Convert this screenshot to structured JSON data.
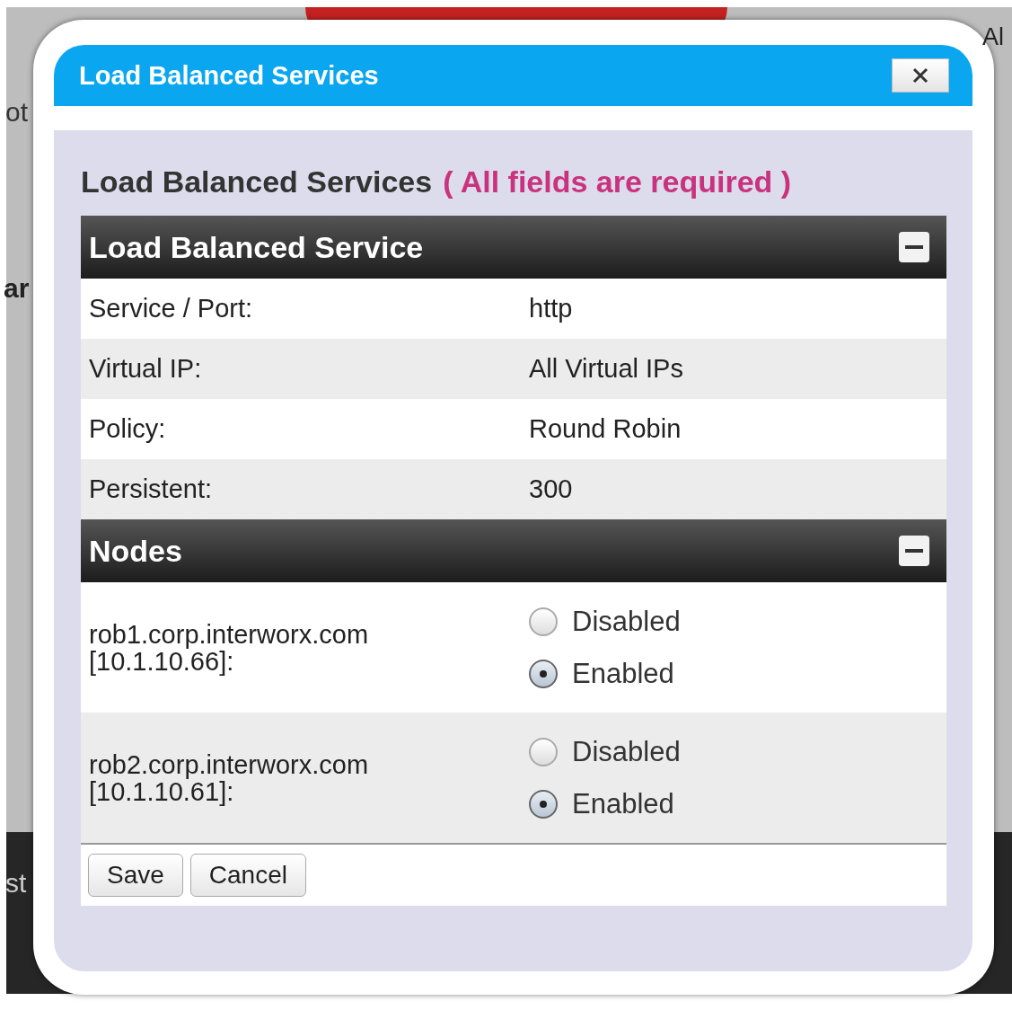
{
  "background": {
    "fragments": [
      "Al",
      "ot",
      "ar",
      "st"
    ]
  },
  "dialog": {
    "title": "Load Balanced Services"
  },
  "heading": "Load Balanced Services",
  "required_note": "( All fields are required )",
  "service": {
    "title": "Load Balanced Service",
    "rows": [
      {
        "label": "Service / Port:",
        "value": "http"
      },
      {
        "label": "Virtual IP:",
        "value": "All Virtual IPs"
      },
      {
        "label": "Policy:",
        "value": "Round Robin"
      },
      {
        "label": "Persistent:",
        "value": "300"
      }
    ]
  },
  "nodes": {
    "title": "Nodes",
    "items": [
      {
        "name": "rob1.corp.interworx.com",
        "address": "[10.1.10.66]:",
        "options": [
          {
            "label": "Disabled",
            "selected": false
          },
          {
            "label": "Enabled",
            "selected": true
          }
        ]
      },
      {
        "name": "rob2.corp.interworx.com",
        "address": "[10.1.10.61]:",
        "options": [
          {
            "label": "Disabled",
            "selected": false
          },
          {
            "label": "Enabled",
            "selected": true
          }
        ]
      }
    ]
  },
  "buttons": [
    "Save",
    "Cancel"
  ]
}
